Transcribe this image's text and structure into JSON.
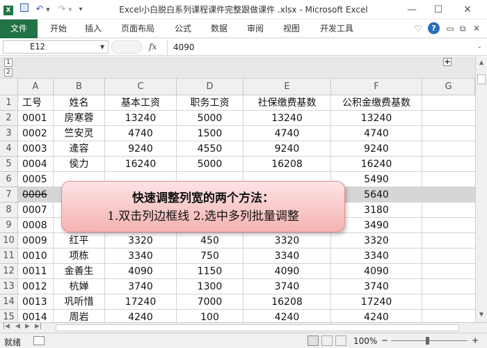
{
  "window": {
    "title": "Excel小白脱白系列课程课件完整跟做课件 .xlsx  -  Microsoft Excel",
    "min": "—",
    "max": "☐",
    "close": "✕"
  },
  "ribbon": {
    "file_tab": "文件",
    "tabs": [
      "开始",
      "插入",
      "页面布局",
      "公式",
      "数据",
      "审阅",
      "视图",
      "开发工具"
    ],
    "help": "?"
  },
  "formula_bar": {
    "name_box": "E12",
    "fx": "fx",
    "value": "4090"
  },
  "outline": {
    "level1": "1",
    "level2": "2",
    "expand": "+"
  },
  "columns": [
    "A",
    "B",
    "C",
    "D",
    "E",
    "F",
    "G"
  ],
  "rows": [
    {
      "num": "1",
      "cells": [
        "工号",
        "姓名",
        "基本工资",
        "职务工资",
        "社保缴费基数",
        "公积金缴费基数",
        ""
      ]
    },
    {
      "num": "2",
      "cells": [
        "0001",
        "房寒蓉",
        "13240",
        "5000",
        "13240",
        "13240",
        ""
      ]
    },
    {
      "num": "3",
      "cells": [
        "0002",
        "竺安灵",
        "4740",
        "1500",
        "4740",
        "4740",
        ""
      ]
    },
    {
      "num": "4",
      "cells": [
        "0003",
        "逄容",
        "9240",
        "4550",
        "9240",
        "9240",
        ""
      ]
    },
    {
      "num": "5",
      "cells": [
        "0004",
        "侯力",
        "16240",
        "5000",
        "16208",
        "16240",
        ""
      ]
    },
    {
      "num": "6",
      "cells": [
        "0005",
        "",
        "",
        "",
        "",
        "5490",
        ""
      ]
    },
    {
      "num": "7",
      "cells": [
        "0006",
        "",
        "",
        "",
        "",
        "5640",
        ""
      ]
    },
    {
      "num": "8",
      "cells": [
        "0007",
        "",
        "",
        "",
        "",
        "3180",
        ""
      ]
    },
    {
      "num": "9",
      "cells": [
        "0008",
        "",
        "",
        "",
        "",
        "3490",
        ""
      ]
    },
    {
      "num": "10",
      "cells": [
        "0009",
        "红平",
        "3320",
        "450",
        "3320",
        "3320",
        ""
      ]
    },
    {
      "num": "11",
      "cells": [
        "0010",
        "项栋",
        "3340",
        "750",
        "3340",
        "3340",
        ""
      ]
    },
    {
      "num": "12",
      "cells": [
        "0011",
        "金善生",
        "4090",
        "1150",
        "4090",
        "4090",
        ""
      ]
    },
    {
      "num": "13",
      "cells": [
        "0012",
        "杭婵",
        "3740",
        "1300",
        "3740",
        "3740",
        ""
      ]
    },
    {
      "num": "14",
      "cells": [
        "0013",
        "巩听惜",
        "17240",
        "7000",
        "16208",
        "17240",
        ""
      ]
    },
    {
      "num": "15",
      "cells": [
        "0014",
        "周岩",
        "4240",
        "100",
        "4240",
        "4240",
        ""
      ]
    }
  ],
  "callout": {
    "title": "快速调整列宽的两个方法：",
    "body": "1.双击列边框线  2.选中多列批量调整"
  },
  "status": {
    "ready": "就绪",
    "zoom": "100%"
  },
  "colors": {
    "file_tab": "#217346",
    "callout": "#f5b2b2",
    "help": "#2a6ebb"
  }
}
